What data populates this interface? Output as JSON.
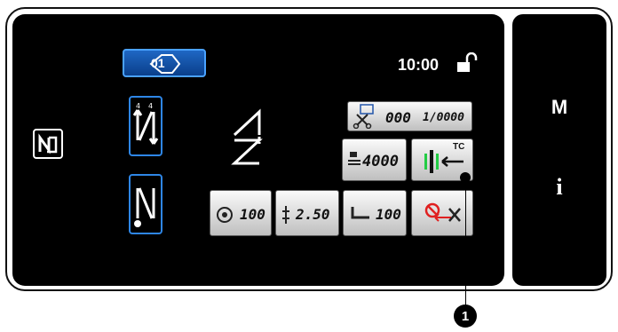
{
  "header": {
    "time": "10:00",
    "pattern_button": {
      "icon": "pattern-return-icon",
      "label": "01"
    }
  },
  "counter": {
    "value": "000",
    "total": "1/0000",
    "icon": "thread-cut-counter-icon"
  },
  "presser": {
    "value": "4000",
    "icon": "presser-height-icon"
  },
  "tension_button": {
    "label": "TC",
    "icon": "thread-tension-icon"
  },
  "bottom_row": {
    "speed": {
      "value": "100",
      "icon": "speed-icon"
    },
    "pitch": {
      "value": "2.50",
      "icon": "stitch-pitch-icon"
    },
    "foot": {
      "value": "100",
      "icon": "presser-foot-icon"
    },
    "trim_off": {
      "icon": "thread-trim-prohibit-icon"
    }
  },
  "side": {
    "mode_label": "M",
    "info_label": "i"
  },
  "callout": {
    "label": "1"
  },
  "colors": {
    "screen": "#000000",
    "accent_blue": "#2e86e6",
    "green": "#22cc44",
    "red": "#e02020"
  }
}
